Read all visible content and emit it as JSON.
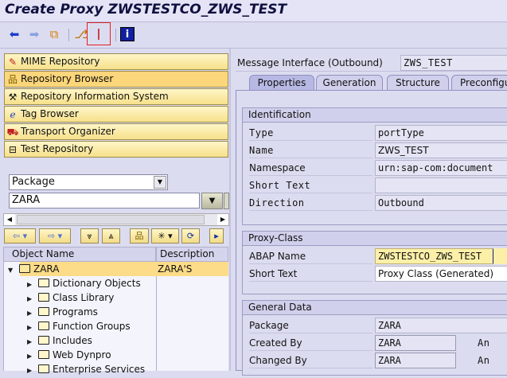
{
  "title": "Create Proxy ZWSTESTCO_ZWS_TEST",
  "toolbar": {
    "icons": [
      "back-icon",
      "forward-icon",
      "other-object-icon",
      "hierarchy-icon",
      "generate-wand-icon",
      "info-icon"
    ]
  },
  "nav_buttons": [
    {
      "label": "MIME Repository",
      "icon": "mime-icon"
    },
    {
      "label": "Repository Browser",
      "icon": "repository-browser-icon",
      "selected": true
    },
    {
      "label": "Repository Information System",
      "icon": "info-system-icon"
    },
    {
      "label": "Tag Browser",
      "icon": "tag-browser-icon"
    },
    {
      "label": "Transport Organizer",
      "icon": "transport-icon"
    },
    {
      "label": "Test Repository",
      "icon": "test-repository-icon"
    }
  ],
  "object_type": {
    "selected": "Package"
  },
  "object_name": {
    "value": "ZARA"
  },
  "tree": {
    "columns": [
      "Object Name",
      "Description"
    ],
    "root": {
      "name": "ZARA",
      "description": "ZARA'S"
    },
    "children": [
      "Dictionary Objects",
      "Class Library",
      "Programs",
      "Function Groups",
      "Includes",
      "Web Dynpro",
      "Enterprise Services"
    ]
  },
  "interface": {
    "label": "Message Interface (Outbound)",
    "value": "ZWS_TEST"
  },
  "tabs": [
    "Properties",
    "Generation",
    "Structure",
    "Preconfiguration"
  ],
  "identification": {
    "title": "Identification",
    "fields": [
      {
        "label": "Type",
        "value": "portType"
      },
      {
        "label": "Name",
        "value": "ZWS_TEST"
      },
      {
        "label": "Namespace",
        "value": "urn:sap-com:document"
      },
      {
        "label": "Short Text",
        "value": ""
      },
      {
        "label": "Direction",
        "value": "Outbound"
      }
    ]
  },
  "proxy_class": {
    "title": "Proxy-Class",
    "abap_name_label": "ABAP Name",
    "abap_name": "ZWSTESTCO_ZWS_TEST",
    "short_text_label": "Short Text",
    "short_text": "Proxy Class (Generated)"
  },
  "general": {
    "title": "General Data",
    "package_label": "Package",
    "package": "ZARA",
    "created_label": "Created By",
    "created": "ZARA",
    "created_extra": "An",
    "changed_label": "Changed By",
    "changed": "ZARA",
    "changed_extra": "An"
  }
}
